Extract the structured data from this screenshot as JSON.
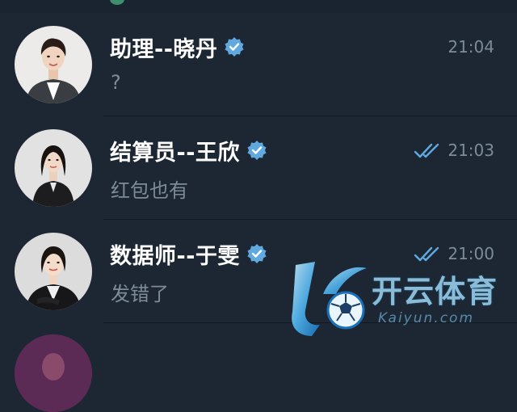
{
  "chats": [
    {
      "name": "助理--晓丹",
      "preview": "?",
      "time": "21:04",
      "verified": true,
      "read_receipt": false,
      "avatar": "woman-avatar-grey-suit"
    },
    {
      "name": "结算员--王欣",
      "preview": "红包也有",
      "time": "21:03",
      "verified": true,
      "read_receipt": true,
      "avatar": "woman-avatar-dark-dress"
    },
    {
      "name": "数据师--于雯",
      "preview": "发错了",
      "time": "21:00",
      "verified": true,
      "read_receipt": true,
      "avatar": "woman-avatar-black-blazer"
    }
  ],
  "watermark": {
    "brand": "开云体育",
    "sub": "Kaiyun.com"
  },
  "colors": {
    "background": "#1c2733",
    "verified_badge": "#5fa8e0",
    "read_check": "#5fa8e0",
    "muted_text": "#7e8c99"
  }
}
